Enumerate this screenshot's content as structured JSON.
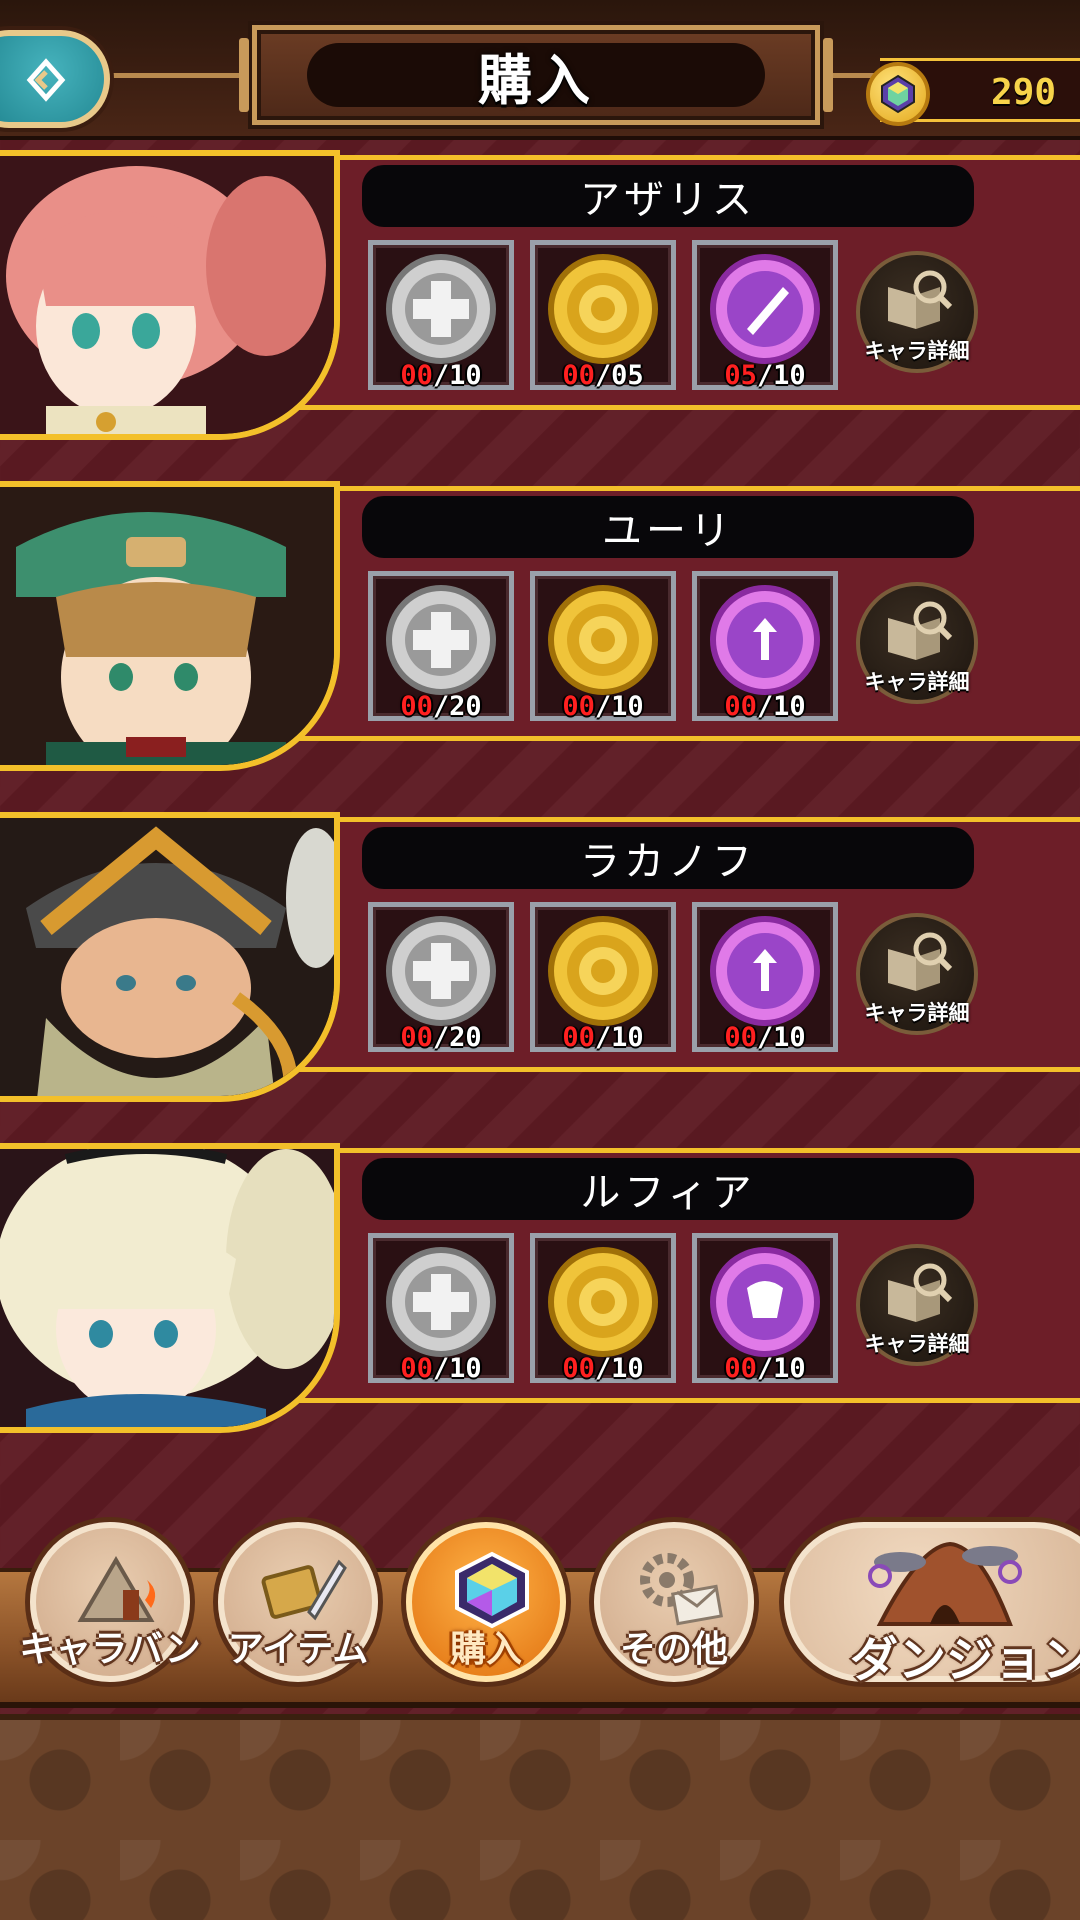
{
  "header": {
    "title": "購入",
    "currency_value": "290",
    "back_icon": "back-arrow-icon",
    "currency_icon": "gem-icon"
  },
  "characters": [
    {
      "name": "アザリス",
      "stones": [
        {
          "type": "silver",
          "owned": "00",
          "max": "10"
        },
        {
          "type": "gold",
          "owned": "00",
          "max": "05"
        },
        {
          "type": "purple",
          "owned": "05",
          "max": "10"
        }
      ],
      "detail_label": "キャラ詳細"
    },
    {
      "name": "ユーリ",
      "stones": [
        {
          "type": "silver",
          "owned": "00",
          "max": "20"
        },
        {
          "type": "gold",
          "owned": "00",
          "max": "10"
        },
        {
          "type": "purple",
          "owned": "00",
          "max": "10"
        }
      ],
      "detail_label": "キャラ詳細"
    },
    {
      "name": "ラカノフ",
      "stones": [
        {
          "type": "silver",
          "owned": "00",
          "max": "20"
        },
        {
          "type": "gold",
          "owned": "00",
          "max": "10"
        },
        {
          "type": "purple",
          "owned": "00",
          "max": "10"
        }
      ],
      "detail_label": "キャラ詳細"
    },
    {
      "name": "ルフィア",
      "stones": [
        {
          "type": "silver",
          "owned": "00",
          "max": "10"
        },
        {
          "type": "gold",
          "owned": "00",
          "max": "10"
        },
        {
          "type": "purple",
          "owned": "00",
          "max": "10"
        }
      ],
      "detail_label": "キャラ詳細"
    }
  ],
  "nav": {
    "items": [
      {
        "label": "キャラバン",
        "icon": "tent-icon",
        "active": false
      },
      {
        "label": "アイテム",
        "icon": "scroll-sword-icon",
        "active": false
      },
      {
        "label": "購入",
        "icon": "gem-icon",
        "active": true
      },
      {
        "label": "その他",
        "icon": "gear-mail-icon",
        "active": false
      }
    ],
    "dungeon_label": "ダンジョン",
    "dungeon_icon": "dungeon-cave-icon"
  },
  "colors": {
    "accent_gold": "#f3c02a",
    "panel_red": "#6d1e28",
    "active_orange": "#e0700f"
  }
}
